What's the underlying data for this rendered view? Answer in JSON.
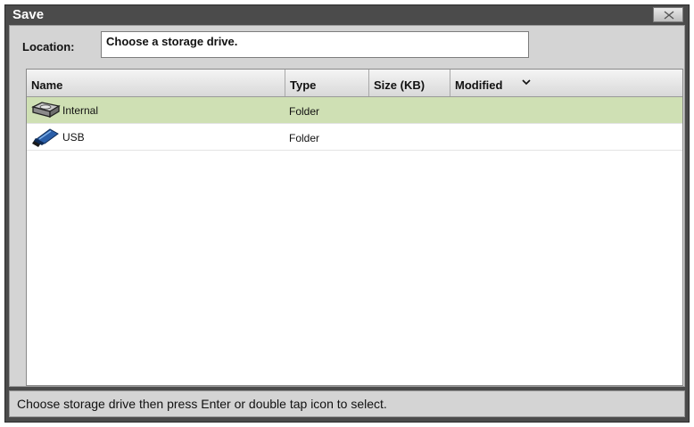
{
  "window": {
    "title": "Save"
  },
  "location": {
    "label": "Location:",
    "value": "Choose a storage drive."
  },
  "columns": {
    "name": "Name",
    "type": "Type",
    "size": "Size (KB)",
    "modified": "Modified"
  },
  "files": [
    {
      "name": "Internal",
      "type": "Folder",
      "icon": "hard-drive-icon",
      "selected": true
    },
    {
      "name": "USB",
      "type": "Folder",
      "icon": "usb-drive-icon",
      "selected": false
    }
  ],
  "status": "Choose storage drive then press Enter or double tap icon to select.",
  "colors": {
    "title_bar": "#4b4b4b",
    "selected_row": "#cfe0b4",
    "panel": "#d4d4d4"
  }
}
